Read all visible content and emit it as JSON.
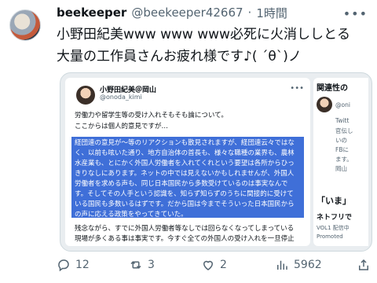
{
  "author": {
    "name": "beekeeper",
    "handle": "@beekeeper42667",
    "separator": "·",
    "time": "1時間"
  },
  "tweet": {
    "text": "小野田紀美www www www必死に火消ししとる\n大量の工作員さんお疲れ様です♪( ´θ`)ノ"
  },
  "embedded": {
    "left": {
      "name": "小野田紀美＠岡山",
      "handle": "@onoda_kimi",
      "lines_top": [
        "労働力や留学生等の受け入れそもそも論について。",
        "ここからは個人的意見ですが…"
      ],
      "lines_highlight": [
        "経団連の意見が〜等のリアクションも散見されますが、経団連云々ではな",
        "く、以前も呟いた通り、地方自治体の首長も、様々な職種の業界も、農林",
        "水産業も、とにかく外国人労働者を入れてくれという要望は各所からひっ",
        "きりなしにあります。ネットの中では見えないかもしれませんが、外国人",
        "労働者を求める声も、同じ日本国民から多数受けているのは事実なんで",
        "す。そしてその人手という認識を、知らず知らずのうちに間接的に受けて",
        "いる国民も多数いるはずです。だから国は今までそういった日本国民から",
        "の声に応える政策をやってきていた。"
      ],
      "lines_bottom": [
        "残念ながら、すでに外国人労働者等なしでは回らなくなってしまっている",
        "現場が多くある事は事実です。今すぐ全ての外国人の受け入れを一旦停止"
      ]
    },
    "right": {
      "title": "関連性の",
      "lines": [
        "@oni",
        "Twitt",
        "官伝し",
        "いの",
        "FBに",
        "ます。",
        "岡山"
      ],
      "heading": "「いま」",
      "trend": "ネトフリで",
      "sub": [
        "VOL1 配信中",
        "Promoted"
      ]
    }
  },
  "actions": {
    "replies": "12",
    "reposts": "3",
    "likes": "2",
    "views": "5962"
  }
}
